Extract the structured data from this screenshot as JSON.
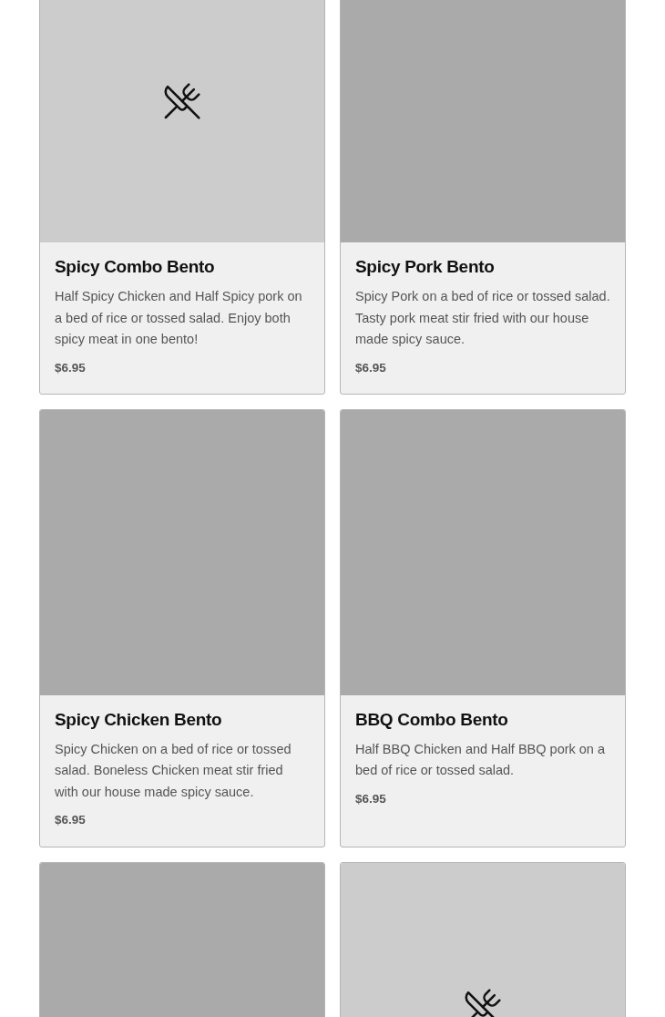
{
  "cards": [
    {
      "placeholder_icon": true,
      "title": "Spicy Combo Bento",
      "description": "Half Spicy Chicken and Half Spicy pork on a bed of rice or tossed salad. Enjoy both spicy meat in one bento!",
      "price": "$6.95"
    },
    {
      "placeholder_icon": false,
      "title": "Spicy Pork Bento",
      "description": "Spicy Pork on a bed of rice or tossed salad. Tasty pork meat stir fried with our house made spicy sauce.",
      "price": "$6.95"
    },
    {
      "placeholder_icon": false,
      "title": "Spicy Chicken Bento",
      "description": "Spicy Chicken on a bed of rice or tossed salad. Boneless Chicken meat stir fried with our house made spicy sauce.",
      "price": "$6.95"
    },
    {
      "placeholder_icon": false,
      "title": "BBQ Combo Bento",
      "description": "Half BBQ Chicken and Half BBQ pork on a bed of rice or tossed salad.",
      "price": "$6.95"
    },
    {
      "placeholder_icon": false
    },
    {
      "placeholder_icon": true
    }
  ]
}
